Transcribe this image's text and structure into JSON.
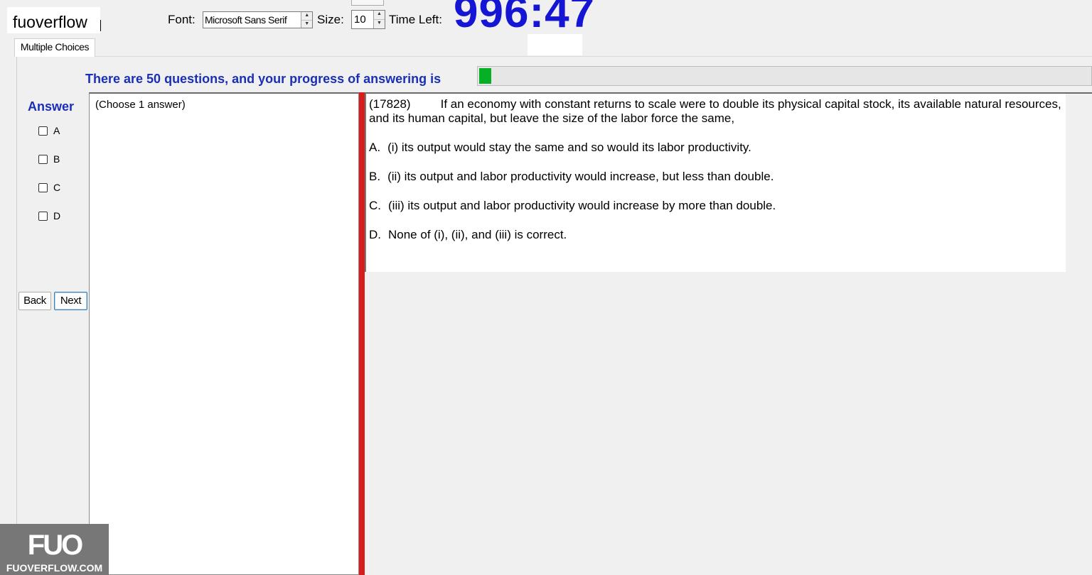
{
  "watermark": {
    "top_text": "fuoverflow",
    "logo_mark": "FUO",
    "logo_text": "FUOVERFLOW.COM"
  },
  "toolbar": {
    "font_label": "Font:",
    "font_value": "Microsoft Sans Serif",
    "size_label": "Size:",
    "size_value": "10",
    "time_label": "Time Left:",
    "time_value": "996:47"
  },
  "tabs": [
    {
      "label": "Multiple Choices",
      "active": true
    }
  ],
  "progress": {
    "label": "There are 50 questions, and your progress of answering is",
    "fraction": 0.02,
    "color": "#06b025"
  },
  "answer_panel": {
    "title": "Answer",
    "options": [
      "A",
      "B",
      "C",
      "D"
    ],
    "instruction": "(Choose 1 answer)"
  },
  "nav": {
    "back_label": "Back",
    "next_label": "Next"
  },
  "question": {
    "number": "(17828)",
    "text": "If an economy with constant returns to scale were to double its physical capital stock, its available natural resources, and its human capital, but leave the size of the labor force the same,",
    "options": [
      {
        "key": "A.",
        "text": "(i) its output would stay the same and so would its labor productivity."
      },
      {
        "key": "B.",
        "text": "(ii) its output and labor productivity would increase, but less than double."
      },
      {
        "key": "C.",
        "text": "(iii) its output and labor productivity would increase by more than double."
      },
      {
        "key": "D.",
        "text": "None of (i), (ii), and (iii) is correct."
      }
    ]
  },
  "colors": {
    "accent_blue": "#1a2fb8",
    "timer_blue": "#1515d4",
    "divider_red": "#d81b1b"
  }
}
